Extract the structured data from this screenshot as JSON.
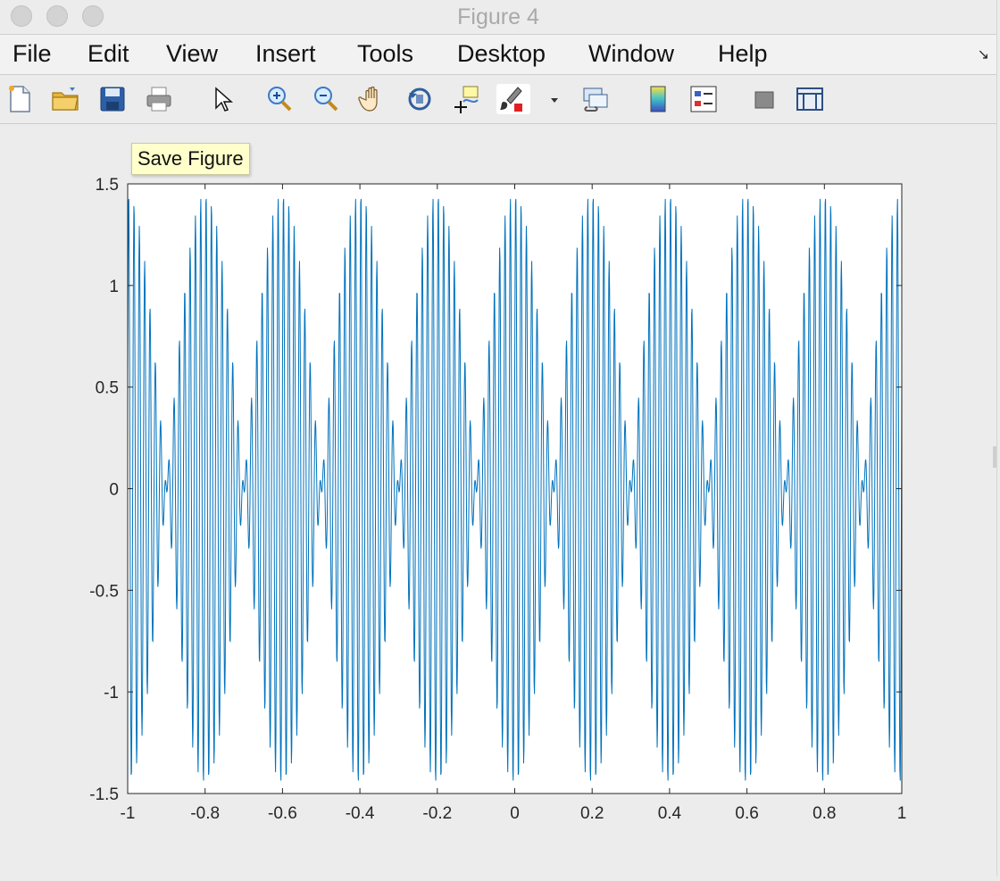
{
  "window": {
    "title": "Figure 4"
  },
  "menu": {
    "items": [
      "File",
      "Edit",
      "View",
      "Insert",
      "Tools",
      "Desktop",
      "Window",
      "Help"
    ]
  },
  "toolbar": {
    "buttons": [
      {
        "name": "new-figure",
        "icon": "new-file-icon"
      },
      {
        "name": "open-file",
        "icon": "folder-icon"
      },
      {
        "name": "save-figure",
        "icon": "floppy-disk-icon"
      },
      {
        "name": "print-figure",
        "icon": "printer-icon"
      },
      {
        "name": "edit-plot",
        "icon": "arrow-cursor-icon"
      },
      {
        "name": "zoom-in",
        "icon": "zoom-in-icon"
      },
      {
        "name": "zoom-out",
        "icon": "zoom-out-icon"
      },
      {
        "name": "pan",
        "icon": "hand-icon"
      },
      {
        "name": "rotate-3d",
        "icon": "rotate-icon"
      },
      {
        "name": "data-cursor",
        "icon": "data-cursor-icon"
      },
      {
        "name": "brush",
        "icon": "brush-icon"
      },
      {
        "name": "link-plot",
        "icon": "link-icon"
      },
      {
        "name": "insert-colorbar",
        "icon": "colorbar-icon"
      },
      {
        "name": "insert-legend",
        "icon": "legend-icon"
      },
      {
        "name": "hide-plot-tools",
        "icon": "hide-tools-icon"
      },
      {
        "name": "show-plot-tools",
        "icon": "show-tools-icon"
      }
    ],
    "tooltip": "Save Figure"
  },
  "colors": {
    "line": "#0072BD",
    "axes_bg": "#ffffff",
    "figure_bg": "#ececec",
    "tooltip_bg": "#ffffcc"
  },
  "chart_data": {
    "type": "line",
    "title": "",
    "xlabel": "",
    "ylabel": "",
    "xlim": [
      -1,
      1
    ],
    "ylim": [
      -1.5,
      1.5
    ],
    "xticks": [
      -1,
      -0.8,
      -0.6,
      -0.4,
      -0.2,
      0,
      0.2,
      0.4,
      0.6,
      0.8,
      1
    ],
    "xtick_labels": [
      "-1",
      "-0.8",
      "-0.6",
      "-0.4",
      "-0.2",
      "0",
      "0.2",
      "0.4",
      "0.6",
      "0.8",
      "1"
    ],
    "yticks": [
      -1.5,
      -1,
      -0.5,
      0,
      0.5,
      1,
      1.5
    ],
    "ytick_labels": [
      "-1.5",
      "-1",
      "-0.5",
      "0",
      "0.5",
      "1",
      "1.5"
    ],
    "grid": false,
    "legend": "none",
    "series": [
      {
        "description_of_shape": "dense oscillation; sum of sinusoids, peaks near ±1.45",
        "x_range": [
          -1,
          1
        ],
        "y_peak": 1.45,
        "components": [
          {
            "amplitude": 0.75,
            "cycles_per_unit": 75
          },
          {
            "amplitude": 0.75,
            "cycles_per_unit": 70
          }
        ]
      }
    ]
  }
}
